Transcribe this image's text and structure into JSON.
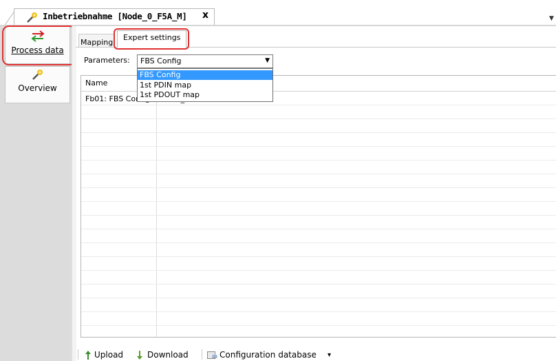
{
  "document_tab": {
    "title": "Inbetriebnahme [Node_0_F5A_M]",
    "close": "x",
    "overflow": "▼"
  },
  "nav": {
    "items": [
      {
        "label": "Process data",
        "icon": "exchange-arrows-icon"
      },
      {
        "label": "Overview",
        "icon": "wand-icon"
      }
    ]
  },
  "subtabs": [
    {
      "label": "Mapping"
    },
    {
      "label": "Expert settings"
    }
  ],
  "parameters": {
    "label": "Parameters:",
    "selected": "FBS Config",
    "options": [
      "FBS Config",
      "1st PDIN map",
      "1st PDOUT map"
    ]
  },
  "grid": {
    "columns": [
      "Name"
    ],
    "rows": [
      {
        "name": "Fb01: FBS Config: Enable_DA"
      }
    ]
  },
  "toolbar": {
    "upload": "Upload",
    "download": "Download",
    "config_db": "Configuration database",
    "config_db_arrow": "▾"
  },
  "colors": {
    "highlight": "#e03030",
    "selection": "#3399ff",
    "panel": "#dcdcdc"
  }
}
